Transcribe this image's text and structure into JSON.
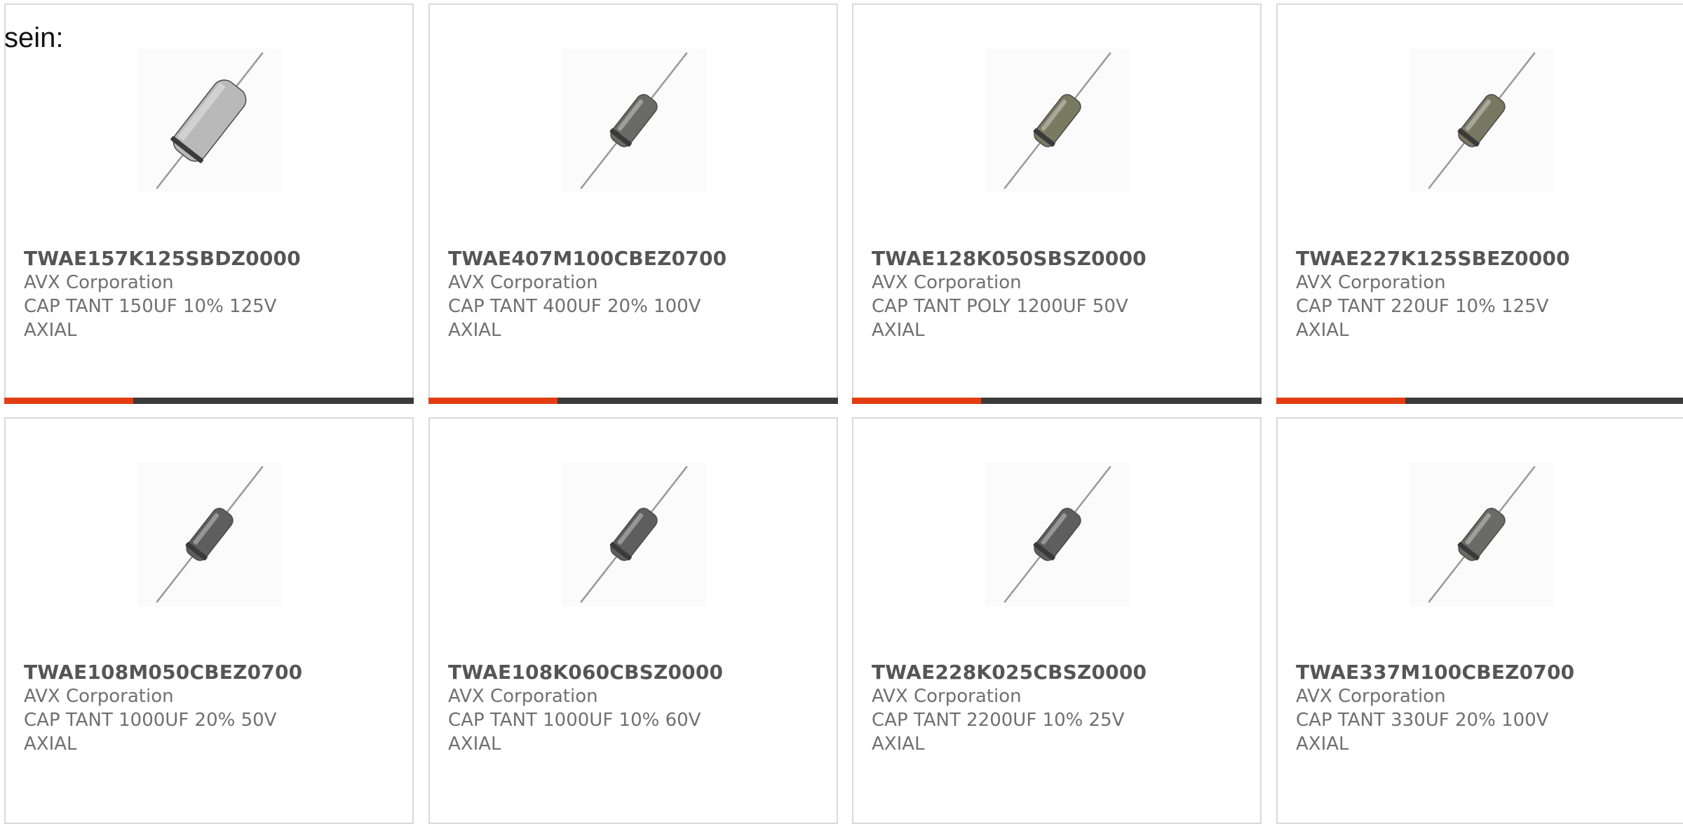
{
  "intro_text": "sein:",
  "colors": {
    "accent": "#e23d13",
    "bar_dark": "#3b3b3b",
    "card_border": "#d9d9d9",
    "text_muted": "#707070"
  },
  "products": [
    {
      "part_number": "TWAE157K125SBDZ0000",
      "manufacturer": "AVX Corporation",
      "description": "CAP TANT 150UF 10% 125V",
      "package": "AXIAL",
      "image_icon": "axial-capacitor-icon",
      "capacitor_color": "#b9b9b9"
    },
    {
      "part_number": "TWAE407M100CBEZ0700",
      "manufacturer": "AVX Corporation",
      "description": "CAP TANT 400UF 20% 100V",
      "package": "AXIAL",
      "image_icon": "axial-capacitor-icon",
      "capacitor_color": "#6a6a66"
    },
    {
      "part_number": "TWAE128K050SBSZ0000",
      "manufacturer": "AVX Corporation",
      "description": "CAP TANT POLY 1200UF 50V",
      "package": "AXIAL",
      "image_icon": "axial-capacitor-icon",
      "capacitor_color": "#7a7a62"
    },
    {
      "part_number": "TWAE227K125SBEZ0000",
      "manufacturer": "AVX Corporation",
      "description": "CAP TANT 220UF 10% 125V",
      "package": "AXIAL",
      "image_icon": "axial-capacitor-icon",
      "capacitor_color": "#787862"
    },
    {
      "part_number": "TWAE108M050CBEZ0700",
      "manufacturer": "AVX Corporation",
      "description": "CAP TANT 1000UF 20% 50V",
      "package": "AXIAL",
      "image_icon": "axial-capacitor-icon",
      "capacitor_color": "#5e5e5e"
    },
    {
      "part_number": "TWAE108K060CBSZ0000",
      "manufacturer": "AVX Corporation",
      "description": "CAP TANT 1000UF 10% 60V",
      "package": "AXIAL",
      "image_icon": "axial-capacitor-icon",
      "capacitor_color": "#5e5e5e"
    },
    {
      "part_number": "TWAE228K025CBSZ0000",
      "manufacturer": "AVX Corporation",
      "description": "CAP TANT 2200UF 10% 25V",
      "package": "AXIAL",
      "image_icon": "axial-capacitor-icon",
      "capacitor_color": "#5e5e5e"
    },
    {
      "part_number": "TWAE337M100CBEZ0700",
      "manufacturer": "AVX Corporation",
      "description": "CAP TANT 330UF 20% 100V",
      "package": "AXIAL",
      "image_icon": "axial-capacitor-icon",
      "capacitor_color": "#6a6a66"
    }
  ]
}
